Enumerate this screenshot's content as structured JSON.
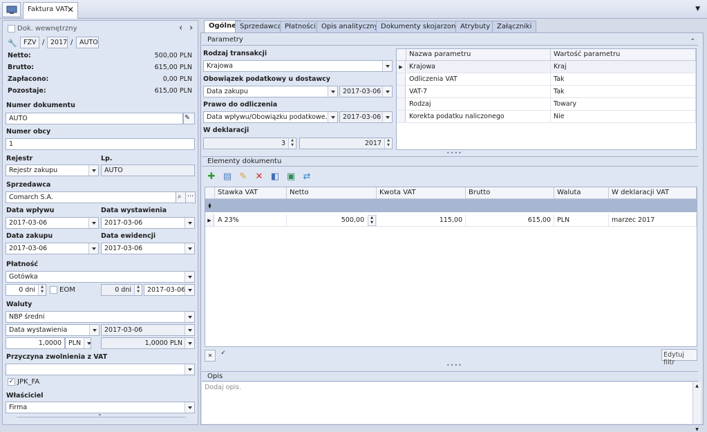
{
  "window": {
    "tab_title": "Faktura VAT",
    "close_glyph": "✕",
    "menu_glyph": "▼",
    "app_icon": "monitor-icon"
  },
  "left": {
    "dok_wewnetrzny": "Dok. wewnętrzny",
    "nav_prev": "‹",
    "nav_next": "›",
    "numbering": {
      "series": "FZV",
      "sep1": "/",
      "year": "2017",
      "sep2": "/",
      "auto": "AUTO"
    },
    "totals": [
      {
        "label": "Netto:",
        "value": "500,00 PLN"
      },
      {
        "label": "Brutto:",
        "value": "615,00 PLN"
      },
      {
        "label": "Zapłacono:",
        "value": "0,00 PLN"
      },
      {
        "label": "Pozostaje:",
        "value": "615,00 PLN"
      }
    ],
    "numer_dokumentu": {
      "label": "Numer dokumentu",
      "value": "AUTO"
    },
    "numer_obcy": {
      "label": "Numer obcy",
      "value": "1"
    },
    "rejestr": {
      "label": "Rejestr",
      "value": "Rejestr zakupu"
    },
    "lp": {
      "label": "Lp.",
      "value": "AUTO"
    },
    "sprzedawca": {
      "label": "Sprzedawca",
      "value": "Comarch S.A.",
      "more": "···"
    },
    "data_wplywu": {
      "label": "Data wpływu",
      "value": "2017-03-06"
    },
    "data_wystawienia": {
      "label": "Data wystawienia",
      "value": "2017-03-06"
    },
    "data_zakupu": {
      "label": "Data zakupu",
      "value": "2017-03-06"
    },
    "data_ewidencji": {
      "label": "Data ewidencji",
      "value": "2017-03-06"
    },
    "platnosc": {
      "label": "Płatność",
      "value": "Gotówka",
      "days1": "0 dni",
      "eom": "EOM",
      "days2": "0 dni",
      "date": "2017-03-06"
    },
    "waluty": {
      "label": "Waluty",
      "value": "NBP średni",
      "rate_type": "Data wystawienia",
      "rate_date": "2017-03-06",
      "rate": "1,0000",
      "currency": "PLN",
      "rate2": "1,0000 PLN"
    },
    "przyczyna": {
      "label": "Przyczyna zwolnienia z VAT",
      "value": ""
    },
    "jpk": {
      "label": "JPK_FA",
      "checked": "✓"
    },
    "wlasciciel": {
      "label": "Właściciel",
      "value": "Firma"
    }
  },
  "tabs": [
    "Ogólne",
    "Sprzedawca",
    "Płatności",
    "Opis analityczny",
    "Dokumenty skojarzone",
    "Atrybuty",
    "Załączniki"
  ],
  "parametry": {
    "title": "Parametry",
    "rodzaj_transakcji": {
      "label": "Rodzaj transakcji",
      "value": "Krajowa"
    },
    "obowiazek": {
      "label": "Obowiązek podatkowy u dostawcy",
      "value": "Data zakupu",
      "date": "2017-03-06"
    },
    "prawo": {
      "label": "Prawo do odliczenia",
      "value": "Data wpływu/Obowiązku podatkowe…",
      "date": "2017-03-06"
    },
    "w_deklaracji": {
      "label": "W deklaracji",
      "month": "3",
      "year": "2017"
    },
    "grid": {
      "columns": [
        "Nazwa parametru",
        "Wartość parametru"
      ],
      "rows": [
        [
          "Krajowa",
          "Kraj"
        ],
        [
          "Odliczenia VAT",
          "Tak"
        ],
        [
          "VAT-7",
          "Tak"
        ],
        [
          "Rodzaj",
          "Towary"
        ],
        [
          "Korekta podatku naliczonego",
          "Nie"
        ]
      ]
    }
  },
  "elementy": {
    "title": "Elementy dokumentu",
    "columns": [
      "Stawka VAT",
      "Netto",
      "Kwota VAT",
      "Brutto",
      "Waluta",
      "W deklaracji VAT"
    ],
    "rows": [
      [
        "A 23%",
        "500,00",
        "115,00",
        "615,00",
        "PLN",
        "marzec 2017"
      ]
    ],
    "footer_check": "✓",
    "footer_clear": "✕",
    "edit_filter": "Edytuj filtr"
  },
  "opis": {
    "title": "Opis",
    "placeholder": "Dodaj opis."
  }
}
